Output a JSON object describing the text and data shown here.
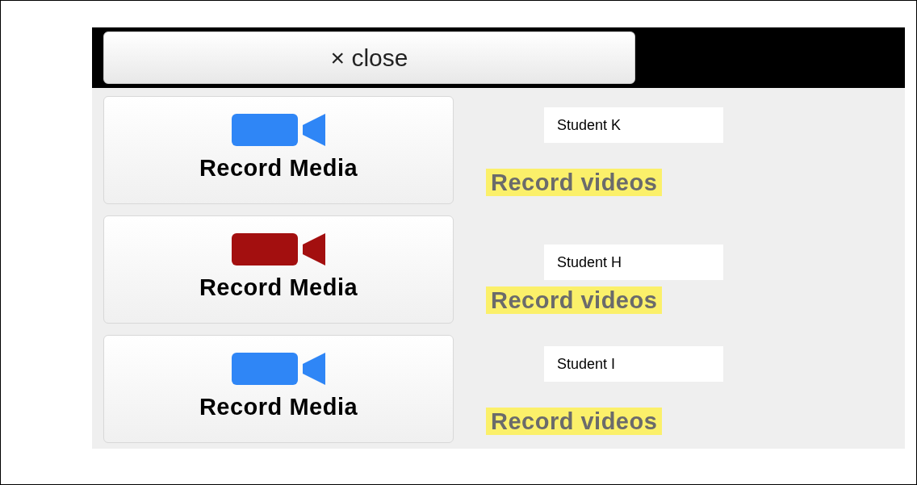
{
  "close_button": {
    "label": "× close"
  },
  "rows": [
    {
      "button": "Record Media",
      "recording": false,
      "student": "Student K",
      "link": "Record videos"
    },
    {
      "button": "Record Media",
      "recording": true,
      "student": "Student H",
      "link": "Record videos"
    },
    {
      "button": "Record Media",
      "recording": false,
      "student": "Student I",
      "link": "Record videos"
    }
  ]
}
